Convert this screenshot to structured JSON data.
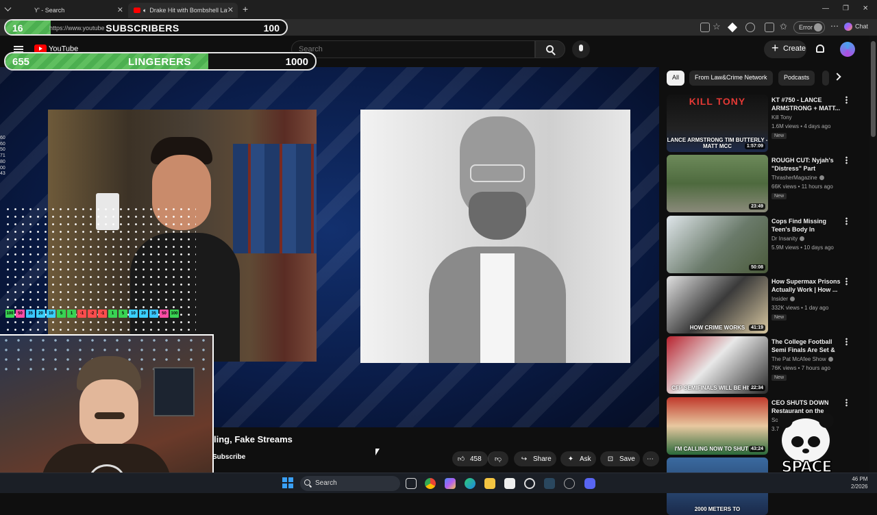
{
  "browser": {
    "tabs": [
      {
        "label": "Y' - Search"
      },
      {
        "label": "Drake Hit with Bombshell Law"
      }
    ],
    "url": "https://www.youtube",
    "error_label": "Error",
    "chat_label": "Chat"
  },
  "overlays": {
    "subscribers": {
      "current": "16",
      "label": "SUBSCRIBERS",
      "goal": "100",
      "progress": 0.16
    },
    "lingerers": {
      "current": "655",
      "label": "LINGERERS",
      "goal": "1000",
      "progress": 0.655
    },
    "number_strip": [
      "100",
      "50",
      "35",
      "20",
      "10",
      "5",
      "1",
      "-1",
      "-2",
      "-1",
      "1",
      "5",
      "10",
      "20",
      "35",
      "50",
      "100"
    ],
    "side_numbers": [
      "60",
      "60",
      "50",
      "71",
      "80",
      "00",
      "43"
    ]
  },
  "youtube": {
    "logo_text": "YouTube",
    "search_placeholder": "Search",
    "create_label": "Create",
    "video_title": "ling, Fake Streams",
    "subscribe_label": "Subscribe",
    "like_count": "458",
    "share_label": "Share",
    "ask_label": "Ask",
    "save_label": "Save",
    "chips": [
      "All",
      "From Law&Crime Network",
      "Podcasts"
    ],
    "recommendations": [
      {
        "title": "KT #750 - LANCE ARMSTRONG + MATT...",
        "channel": "Kill Tony",
        "verified": false,
        "meta": "1.6M views • 4 days ago",
        "badge": "New",
        "duration": "1:57:09",
        "thumb_head": "KILL TONY",
        "thumb_text": "LANCE ARMSTRONG TIM BUTTERLY - MATT MCC"
      },
      {
        "title": "ROUGH CUT: Nyjah's \"Distress\" Part",
        "channel": "ThrasherMagazine",
        "verified": true,
        "meta": "66K views • 11 hours ago",
        "badge": "New",
        "duration": "23:49",
        "thumb_head": "",
        "thumb_text": ""
      },
      {
        "title": "Cops Find Missing Teen's Body In Soldier'...",
        "channel": "Dr Insanity",
        "verified": true,
        "meta": "5.9M views • 10 days ago",
        "badge": "",
        "duration": "50:08",
        "thumb_head": "",
        "thumb_text": ""
      },
      {
        "title": "How Supermax Prisons Actually Work | How ...",
        "channel": "Insider",
        "verified": true,
        "meta": "332K views • 1 day ago",
        "badge": "New",
        "duration": "41:19",
        "thumb_head": "",
        "thumb_text": "HOW CRIME WORKS"
      },
      {
        "title": "The College Football Semi Finals Are Set & ...",
        "channel": "The Pat McAfee Show",
        "verified": true,
        "meta": "76K views • 7 hours ago",
        "badge": "New",
        "duration": "22:34",
        "thumb_head": "",
        "thumb_text": "CFP SEMIFINALS WILL BE HISTOR"
      },
      {
        "title": "CEO SHUTS DOWN Restaurant on the Spo...",
        "channel": "SoReal",
        "verified": false,
        "meta": "3.7",
        "badge": "",
        "duration": "43:24",
        "thumb_head": "",
        "thumb_text": "I'M CALLING NOW TO SHUT IT D"
      },
      {
        "title": "",
        "channel": "",
        "verified": false,
        "meta": "",
        "badge": "",
        "duration": "",
        "thumb_head": "",
        "thumb_text": "2000 METERS TO"
      }
    ]
  },
  "branding": {
    "space_panda": "SPACE PANDA"
  },
  "taskbar": {
    "search_label": "Search",
    "time": "46 PM",
    "date": "2/2026"
  },
  "colors": {
    "meter_green": "#4caf50",
    "yt_red": "#ff0000",
    "video_bg": "#0a1c48"
  }
}
